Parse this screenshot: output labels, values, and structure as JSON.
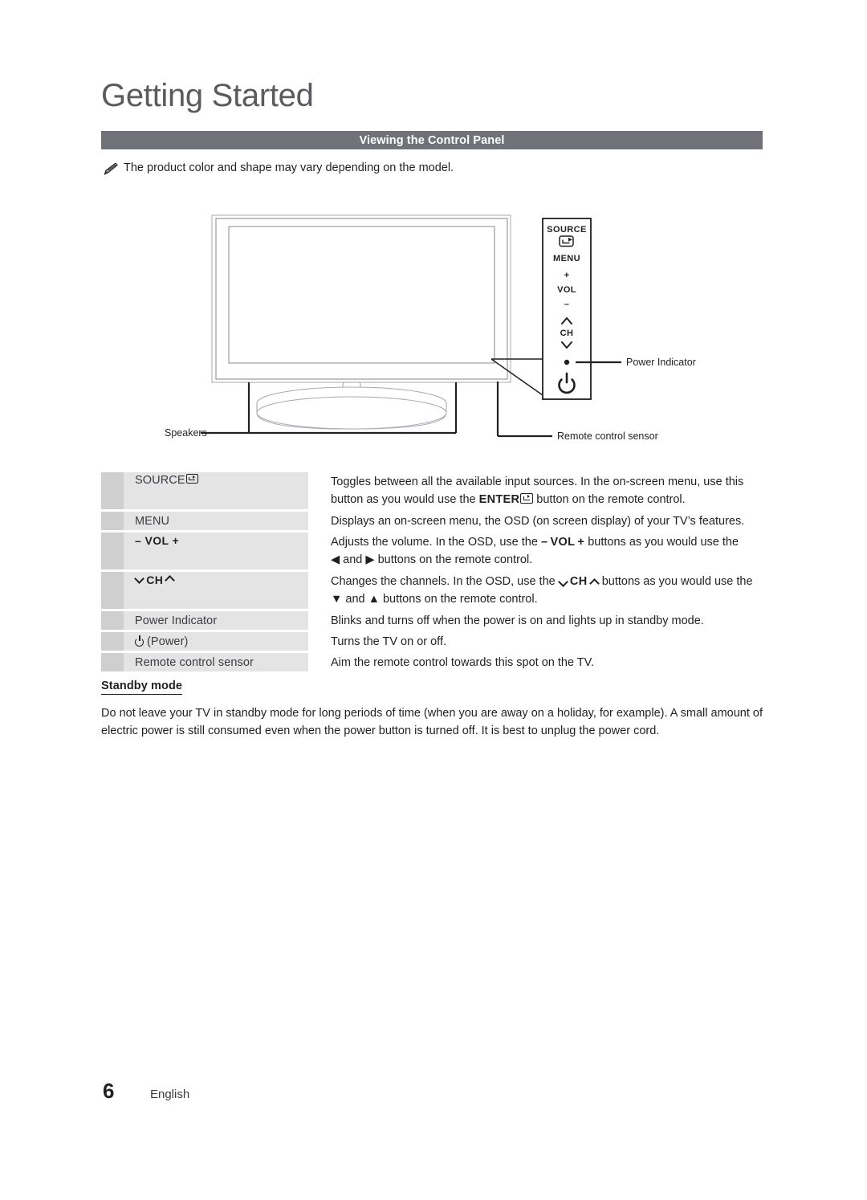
{
  "document": {
    "chapter_title": "Getting Started",
    "section_header": "Viewing the Control Panel",
    "note_text": "The product color and shape may vary depending on the model.",
    "note_icon": "pencil-note-icon"
  },
  "figure": {
    "name": "tv-control-panel-diagram",
    "panel_buttons": [
      {
        "label": "SOURCE",
        "icon": "source-enter-icon"
      },
      {
        "label": "MENU",
        "icon": null
      },
      {
        "label": "+",
        "icon": "plus-icon"
      },
      {
        "label": "VOL",
        "icon": null
      },
      {
        "label": "–",
        "icon": "minus-icon"
      },
      {
        "label": "",
        "icon": "chevron-up-icon"
      },
      {
        "label": "CH",
        "icon": null
      },
      {
        "label": "",
        "icon": "chevron-down-icon"
      },
      {
        "label": "",
        "icon": "power-indicator-dot-icon"
      },
      {
        "label": "",
        "icon": "power-symbol-icon"
      }
    ],
    "callouts": [
      {
        "text": "Power Indicator",
        "name": "callout-power-indicator"
      },
      {
        "text": "Remote control sensor",
        "name": "callout-remote-control-sensor"
      },
      {
        "text": "Speakers",
        "name": "callout-speakers"
      }
    ]
  },
  "table": {
    "rows": [
      {
        "label": "SOURCE",
        "label_icon": "source-enter-icon",
        "label_style": "plain",
        "height": "tall",
        "desc_lines": [
          "Toggles between all the available input sources. In the on-screen menu, use this",
          "button as you would use the ENTER↵ button on the remote control."
        ],
        "desc_plain": "Toggles between all the available input sources. In the on-screen menu, use this button as you would use the ENTER button on the remote control."
      },
      {
        "label": "MENU",
        "label_icon": null,
        "label_style": "plain",
        "height": "short",
        "desc_lines": [
          "Displays an on-screen menu, the OSD (on screen display) of your TV’s features."
        ],
        "desc_plain": "Displays an on-screen menu, the OSD (on screen display) of your TV’s features."
      },
      {
        "label": "– VOL +",
        "label_icon": null,
        "label_style": "bold",
        "height": "tall",
        "desc_lines": [
          "Adjusts the volume. In the OSD, use the – VOL + buttons as you would use the",
          "◀ and ▶ buttons on the remote control."
        ],
        "desc_plain": "Adjusts the volume. In the OSD, use the – VOL + buttons as you would use the ◀ and ▶ buttons on the remote control."
      },
      {
        "label": "∨ CH ∧",
        "label_icon": null,
        "label_style": "bold",
        "height": "tall",
        "desc_lines": [
          "Changes the channels. In the OSD, use the ∨ CH ∧ buttons as you would use the",
          "▼ and ▲ buttons on the remote control."
        ],
        "desc_plain": "Changes the channels. In the OSD, use the ∨ CH ∧ buttons as you would use the ▼ and ▲ buttons on the remote control."
      },
      {
        "label": "Power Indicator",
        "label_icon": null,
        "label_style": "plain",
        "height": "short",
        "desc_lines": [
          "Blinks and turns off when the power is on and lights up in standby mode."
        ],
        "desc_plain": "Blinks and turns off when the power is on and lights up in standby mode."
      },
      {
        "label": "(Power)",
        "label_icon": "power-symbol-icon",
        "label_style": "plain",
        "height": "short",
        "desc_lines": [
          "Turns the TV on or off."
        ],
        "desc_plain": "Turns the TV on or off."
      },
      {
        "label": "Remote control sensor",
        "label_icon": null,
        "label_style": "plain",
        "height": "short",
        "desc_lines": [
          "Aim the remote control towards this spot on the TV."
        ],
        "desc_plain": "Aim the remote control towards this spot on the TV."
      }
    ]
  },
  "standby": {
    "title": "Standby mode",
    "line1": "Do not leave your TV in standby mode for long periods of time (when you are away on a holiday, for example). A small amount",
    "line2": "of electric power is still consumed even when the power button is turned off. It is best to unplug the power cord."
  },
  "footer": {
    "page_number": "6",
    "language": "English"
  },
  "colors": {
    "section_bar": "#71717a",
    "table_bar": "#cfcfcf",
    "table_cell": "#e4e4e4",
    "text": "#231f20",
    "title": "#5a5a5f"
  }
}
